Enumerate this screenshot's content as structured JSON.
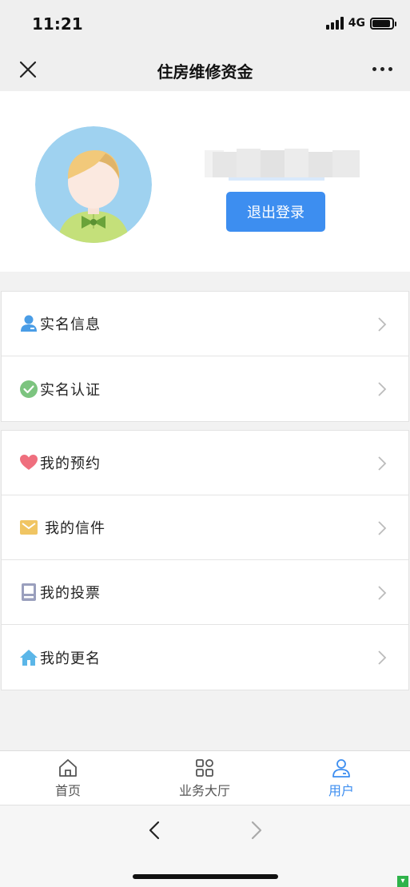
{
  "status_bar": {
    "time": "11:21",
    "network": "4G",
    "battery_level": 0.9
  },
  "nav": {
    "title": "住房维修资金",
    "close_icon": "close-icon",
    "more_icon": "more-icon"
  },
  "profile": {
    "avatar_icon": "avatar-icon",
    "username": "",
    "logout_label": "退出登录"
  },
  "menu_groups": [
    {
      "items": [
        {
          "icon": "user-icon",
          "label": "实名信息",
          "color": "#4a9de6"
        },
        {
          "icon": "check-circle-icon",
          "label": "实名认证",
          "color": "#7cc47f"
        }
      ]
    },
    {
      "items": [
        {
          "icon": "heart-icon",
          "label": "我的预约",
          "color": "#ef6f7e"
        },
        {
          "icon": "mail-icon",
          "label": "我的信件",
          "color": "#f0c563"
        },
        {
          "icon": "ballot-icon",
          "label": "我的投票",
          "color": "#9a9fbd"
        },
        {
          "icon": "home-icon",
          "label": "我的更名",
          "color": "#5bb6e8"
        }
      ]
    }
  ],
  "tabbar": {
    "tabs": [
      {
        "icon": "home-icon",
        "label": "首页",
        "active": false
      },
      {
        "icon": "grid-icon",
        "label": "业务大厅",
        "active": false
      },
      {
        "icon": "user-icon",
        "label": "用户",
        "active": true
      }
    ]
  },
  "colors": {
    "accent": "#3d8ef0",
    "background": "#f2f2f2"
  }
}
